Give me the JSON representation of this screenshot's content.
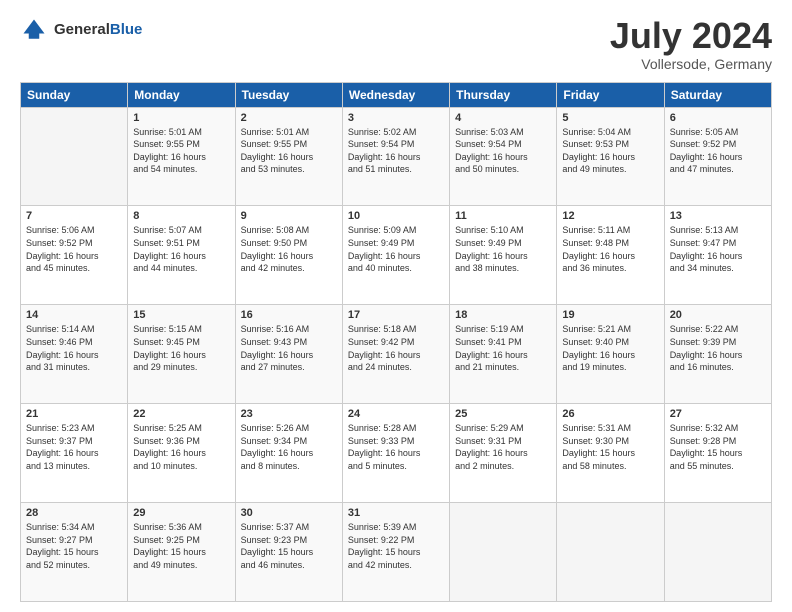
{
  "header": {
    "logo_general": "General",
    "logo_blue": "Blue",
    "title": "July 2024",
    "location": "Vollersode, Germany"
  },
  "days_of_week": [
    "Sunday",
    "Monday",
    "Tuesday",
    "Wednesday",
    "Thursday",
    "Friday",
    "Saturday"
  ],
  "weeks": [
    [
      {
        "day": "",
        "info": ""
      },
      {
        "day": "1",
        "info": "Sunrise: 5:01 AM\nSunset: 9:55 PM\nDaylight: 16 hours\nand 54 minutes."
      },
      {
        "day": "2",
        "info": "Sunrise: 5:01 AM\nSunset: 9:55 PM\nDaylight: 16 hours\nand 53 minutes."
      },
      {
        "day": "3",
        "info": "Sunrise: 5:02 AM\nSunset: 9:54 PM\nDaylight: 16 hours\nand 51 minutes."
      },
      {
        "day": "4",
        "info": "Sunrise: 5:03 AM\nSunset: 9:54 PM\nDaylight: 16 hours\nand 50 minutes."
      },
      {
        "day": "5",
        "info": "Sunrise: 5:04 AM\nSunset: 9:53 PM\nDaylight: 16 hours\nand 49 minutes."
      },
      {
        "day": "6",
        "info": "Sunrise: 5:05 AM\nSunset: 9:52 PM\nDaylight: 16 hours\nand 47 minutes."
      }
    ],
    [
      {
        "day": "7",
        "info": "Sunrise: 5:06 AM\nSunset: 9:52 PM\nDaylight: 16 hours\nand 45 minutes."
      },
      {
        "day": "8",
        "info": "Sunrise: 5:07 AM\nSunset: 9:51 PM\nDaylight: 16 hours\nand 44 minutes."
      },
      {
        "day": "9",
        "info": "Sunrise: 5:08 AM\nSunset: 9:50 PM\nDaylight: 16 hours\nand 42 minutes."
      },
      {
        "day": "10",
        "info": "Sunrise: 5:09 AM\nSunset: 9:49 PM\nDaylight: 16 hours\nand 40 minutes."
      },
      {
        "day": "11",
        "info": "Sunrise: 5:10 AM\nSunset: 9:49 PM\nDaylight: 16 hours\nand 38 minutes."
      },
      {
        "day": "12",
        "info": "Sunrise: 5:11 AM\nSunset: 9:48 PM\nDaylight: 16 hours\nand 36 minutes."
      },
      {
        "day": "13",
        "info": "Sunrise: 5:13 AM\nSunset: 9:47 PM\nDaylight: 16 hours\nand 34 minutes."
      }
    ],
    [
      {
        "day": "14",
        "info": "Sunrise: 5:14 AM\nSunset: 9:46 PM\nDaylight: 16 hours\nand 31 minutes."
      },
      {
        "day": "15",
        "info": "Sunrise: 5:15 AM\nSunset: 9:45 PM\nDaylight: 16 hours\nand 29 minutes."
      },
      {
        "day": "16",
        "info": "Sunrise: 5:16 AM\nSunset: 9:43 PM\nDaylight: 16 hours\nand 27 minutes."
      },
      {
        "day": "17",
        "info": "Sunrise: 5:18 AM\nSunset: 9:42 PM\nDaylight: 16 hours\nand 24 minutes."
      },
      {
        "day": "18",
        "info": "Sunrise: 5:19 AM\nSunset: 9:41 PM\nDaylight: 16 hours\nand 21 minutes."
      },
      {
        "day": "19",
        "info": "Sunrise: 5:21 AM\nSunset: 9:40 PM\nDaylight: 16 hours\nand 19 minutes."
      },
      {
        "day": "20",
        "info": "Sunrise: 5:22 AM\nSunset: 9:39 PM\nDaylight: 16 hours\nand 16 minutes."
      }
    ],
    [
      {
        "day": "21",
        "info": "Sunrise: 5:23 AM\nSunset: 9:37 PM\nDaylight: 16 hours\nand 13 minutes."
      },
      {
        "day": "22",
        "info": "Sunrise: 5:25 AM\nSunset: 9:36 PM\nDaylight: 16 hours\nand 10 minutes."
      },
      {
        "day": "23",
        "info": "Sunrise: 5:26 AM\nSunset: 9:34 PM\nDaylight: 16 hours\nand 8 minutes."
      },
      {
        "day": "24",
        "info": "Sunrise: 5:28 AM\nSunset: 9:33 PM\nDaylight: 16 hours\nand 5 minutes."
      },
      {
        "day": "25",
        "info": "Sunrise: 5:29 AM\nSunset: 9:31 PM\nDaylight: 16 hours\nand 2 minutes."
      },
      {
        "day": "26",
        "info": "Sunrise: 5:31 AM\nSunset: 9:30 PM\nDaylight: 15 hours\nand 58 minutes."
      },
      {
        "day": "27",
        "info": "Sunrise: 5:32 AM\nSunset: 9:28 PM\nDaylight: 15 hours\nand 55 minutes."
      }
    ],
    [
      {
        "day": "28",
        "info": "Sunrise: 5:34 AM\nSunset: 9:27 PM\nDaylight: 15 hours\nand 52 minutes."
      },
      {
        "day": "29",
        "info": "Sunrise: 5:36 AM\nSunset: 9:25 PM\nDaylight: 15 hours\nand 49 minutes."
      },
      {
        "day": "30",
        "info": "Sunrise: 5:37 AM\nSunset: 9:23 PM\nDaylight: 15 hours\nand 46 minutes."
      },
      {
        "day": "31",
        "info": "Sunrise: 5:39 AM\nSunset: 9:22 PM\nDaylight: 15 hours\nand 42 minutes."
      },
      {
        "day": "",
        "info": ""
      },
      {
        "day": "",
        "info": ""
      },
      {
        "day": "",
        "info": ""
      }
    ]
  ]
}
